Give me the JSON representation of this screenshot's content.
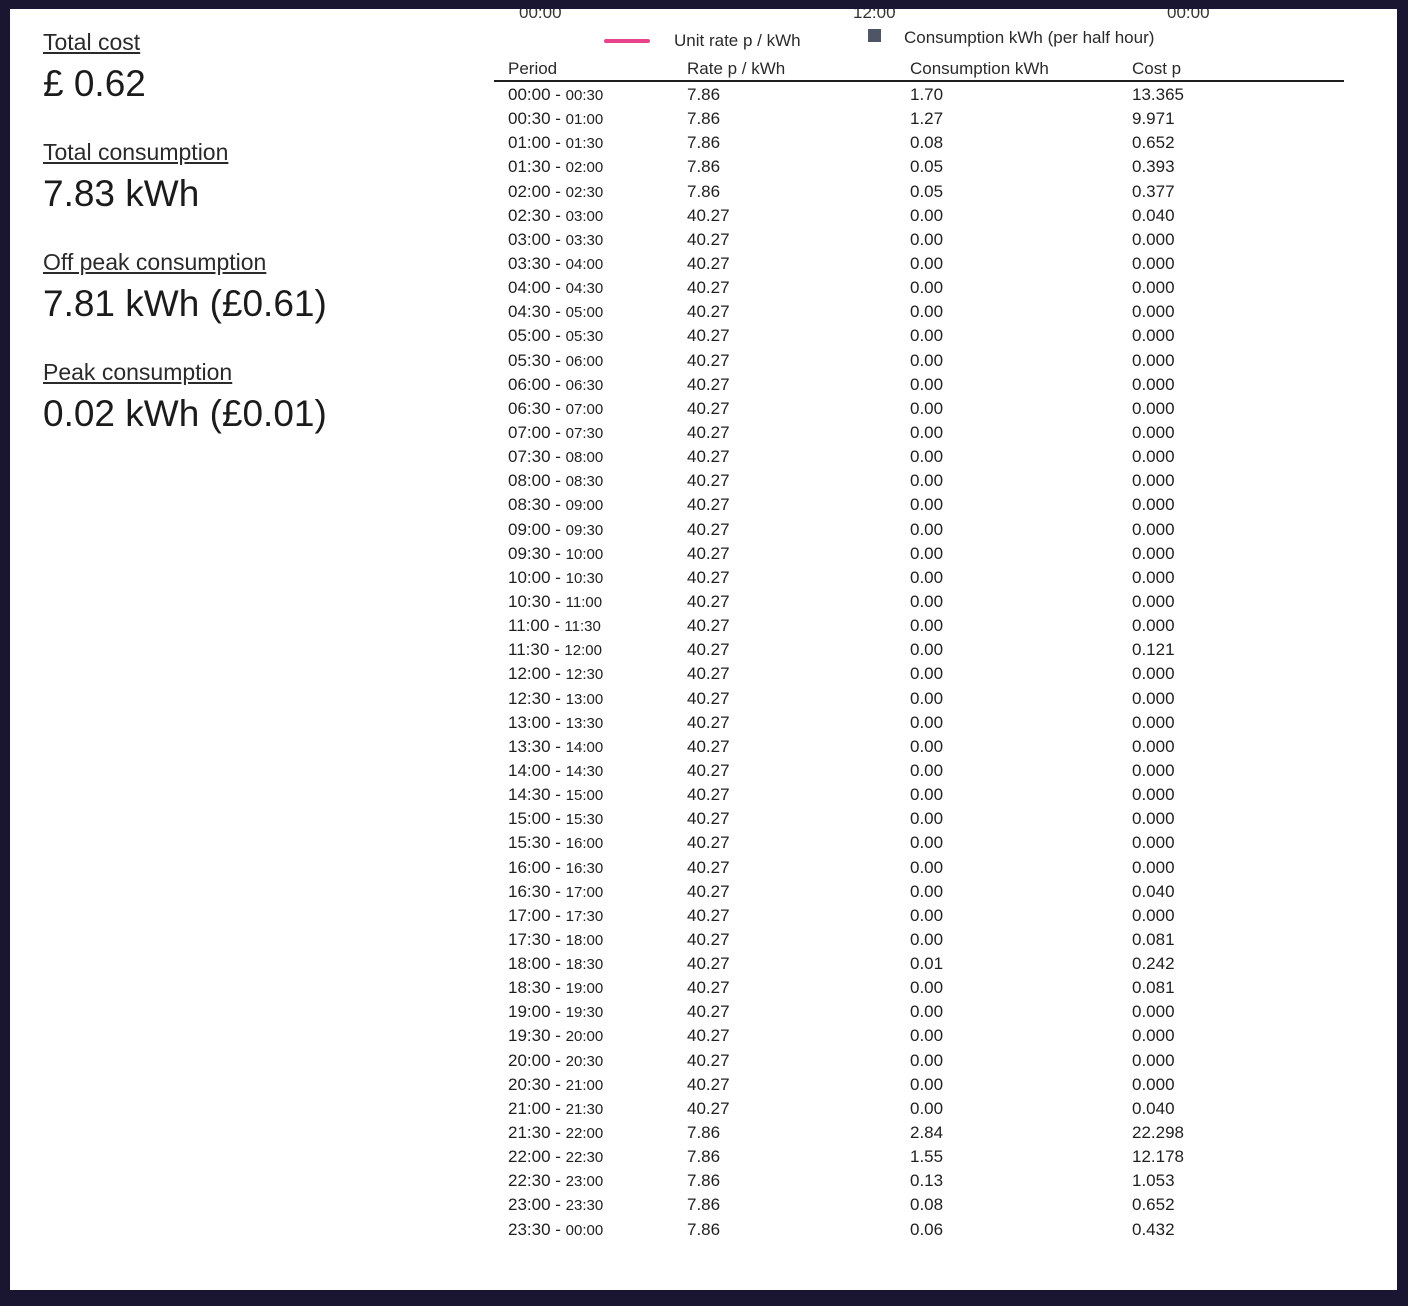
{
  "chart_header": {
    "ticks": [
      "00:00",
      "12:00",
      "00:00"
    ],
    "legend_rate": "Unit rate p / kWh",
    "legend_consumption": "Consumption kWh (per half hour)"
  },
  "summary": {
    "total_cost_label": "Total cost",
    "total_cost_value": "£ 0.62",
    "total_consumption_label": "Total consumption",
    "total_consumption_value": "7.83 kWh",
    "off_peak_label": "Off peak consumption",
    "off_peak_value": "7.81 kWh (£0.61)",
    "peak_label": "Peak consumption",
    "peak_value": "0.02 kWh (£0.01)"
  },
  "table": {
    "columns": [
      "Period",
      "Rate p / kWh",
      "Consumption kWh",
      "Cost p"
    ],
    "rows": [
      [
        "00:00",
        "00:30",
        "7.86",
        "1.70",
        "13.365"
      ],
      [
        "00:30",
        "01:00",
        "7.86",
        "1.27",
        "9.971"
      ],
      [
        "01:00",
        "01:30",
        "7.86",
        "0.08",
        "0.652"
      ],
      [
        "01:30",
        "02:00",
        "7.86",
        "0.05",
        "0.393"
      ],
      [
        "02:00",
        "02:30",
        "7.86",
        "0.05",
        "0.377"
      ],
      [
        "02:30",
        "03:00",
        "40.27",
        "0.00",
        "0.040"
      ],
      [
        "03:00",
        "03:30",
        "40.27",
        "0.00",
        "0.000"
      ],
      [
        "03:30",
        "04:00",
        "40.27",
        "0.00",
        "0.000"
      ],
      [
        "04:00",
        "04:30",
        "40.27",
        "0.00",
        "0.000"
      ],
      [
        "04:30",
        "05:00",
        "40.27",
        "0.00",
        "0.000"
      ],
      [
        "05:00",
        "05:30",
        "40.27",
        "0.00",
        "0.000"
      ],
      [
        "05:30",
        "06:00",
        "40.27",
        "0.00",
        "0.000"
      ],
      [
        "06:00",
        "06:30",
        "40.27",
        "0.00",
        "0.000"
      ],
      [
        "06:30",
        "07:00",
        "40.27",
        "0.00",
        "0.000"
      ],
      [
        "07:00",
        "07:30",
        "40.27",
        "0.00",
        "0.000"
      ],
      [
        "07:30",
        "08:00",
        "40.27",
        "0.00",
        "0.000"
      ],
      [
        "08:00",
        "08:30",
        "40.27",
        "0.00",
        "0.000"
      ],
      [
        "08:30",
        "09:00",
        "40.27",
        "0.00",
        "0.000"
      ],
      [
        "09:00",
        "09:30",
        "40.27",
        "0.00",
        "0.000"
      ],
      [
        "09:30",
        "10:00",
        "40.27",
        "0.00",
        "0.000"
      ],
      [
        "10:00",
        "10:30",
        "40.27",
        "0.00",
        "0.000"
      ],
      [
        "10:30",
        "11:00",
        "40.27",
        "0.00",
        "0.000"
      ],
      [
        "11:00",
        "11:30",
        "40.27",
        "0.00",
        "0.000"
      ],
      [
        "11:30",
        "12:00",
        "40.27",
        "0.00",
        "0.121"
      ],
      [
        "12:00",
        "12:30",
        "40.27",
        "0.00",
        "0.000"
      ],
      [
        "12:30",
        "13:00",
        "40.27",
        "0.00",
        "0.000"
      ],
      [
        "13:00",
        "13:30",
        "40.27",
        "0.00",
        "0.000"
      ],
      [
        "13:30",
        "14:00",
        "40.27",
        "0.00",
        "0.000"
      ],
      [
        "14:00",
        "14:30",
        "40.27",
        "0.00",
        "0.000"
      ],
      [
        "14:30",
        "15:00",
        "40.27",
        "0.00",
        "0.000"
      ],
      [
        "15:00",
        "15:30",
        "40.27",
        "0.00",
        "0.000"
      ],
      [
        "15:30",
        "16:00",
        "40.27",
        "0.00",
        "0.000"
      ],
      [
        "16:00",
        "16:30",
        "40.27",
        "0.00",
        "0.000"
      ],
      [
        "16:30",
        "17:00",
        "40.27",
        "0.00",
        "0.040"
      ],
      [
        "17:00",
        "17:30",
        "40.27",
        "0.00",
        "0.000"
      ],
      [
        "17:30",
        "18:00",
        "40.27",
        "0.00",
        "0.081"
      ],
      [
        "18:00",
        "18:30",
        "40.27",
        "0.01",
        "0.242"
      ],
      [
        "18:30",
        "19:00",
        "40.27",
        "0.00",
        "0.081"
      ],
      [
        "19:00",
        "19:30",
        "40.27",
        "0.00",
        "0.000"
      ],
      [
        "19:30",
        "20:00",
        "40.27",
        "0.00",
        "0.000"
      ],
      [
        "20:00",
        "20:30",
        "40.27",
        "0.00",
        "0.000"
      ],
      [
        "20:30",
        "21:00",
        "40.27",
        "0.00",
        "0.000"
      ],
      [
        "21:00",
        "21:30",
        "40.27",
        "0.00",
        "0.040"
      ],
      [
        "21:30",
        "22:00",
        "7.86",
        "2.84",
        "22.298"
      ],
      [
        "22:00",
        "22:30",
        "7.86",
        "1.55",
        "12.178"
      ],
      [
        "22:30",
        "23:00",
        "7.86",
        "0.13",
        "1.053"
      ],
      [
        "23:00",
        "23:30",
        "7.86",
        "0.08",
        "0.652"
      ],
      [
        "23:30",
        "00:00",
        "7.86",
        "0.06",
        "0.432"
      ]
    ]
  },
  "colors": {
    "rate_line": "#e8428a",
    "consumption_bar": "#4d5566",
    "frame": "#1a1530"
  }
}
